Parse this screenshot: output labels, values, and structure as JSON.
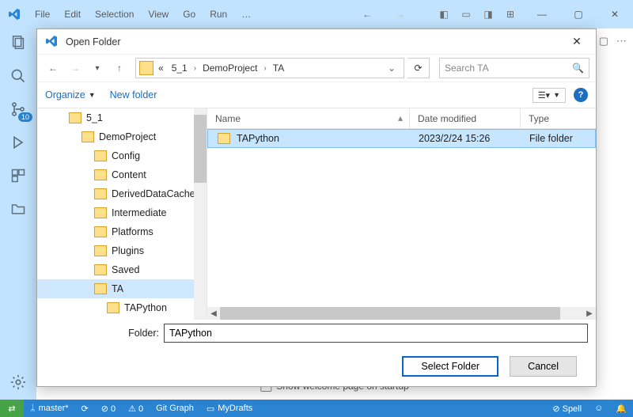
{
  "vsc": {
    "menu": [
      "File",
      "Edit",
      "Selection",
      "View",
      "Go",
      "Run",
      "…"
    ],
    "editor_dots": "⋯",
    "square_icon": "▢",
    "welcome_text": "Show welcome page on startup",
    "status": {
      "branch": "master*",
      "sync": "⟳",
      "errors": "⊘ 0",
      "warnings": "⚠ 0",
      "gitgraph": "Git Graph",
      "mydrafts": "MyDrafts",
      "spell": "⊘ Spell",
      "feedback": "☺",
      "bell": "🔔"
    },
    "badge10": "10"
  },
  "dlg": {
    "title": "Open Folder",
    "breadcrumb": {
      "root": "«",
      "p1": "5_1",
      "p2": "DemoProject",
      "p3": "TA"
    },
    "search_placeholder": "Search TA",
    "organize": "Organize",
    "newfolder": "New folder",
    "help": "?",
    "columns": {
      "name": "Name",
      "date": "Date modified",
      "type": "Type"
    },
    "tree": {
      "n0": "5_1",
      "n1": "DemoProject",
      "n2": "Config",
      "n3": "Content",
      "n4": "DerivedDataCache",
      "n5": "Intermediate",
      "n6": "Platforms",
      "n7": "Plugins",
      "n8": "Saved",
      "n9": "TA",
      "n10": "TAPython"
    },
    "row": {
      "name": "TAPython",
      "date": "2023/2/24 15:26",
      "type": "File folder"
    },
    "folder_label": "Folder:",
    "folder_value": "TAPython",
    "btn_select": "Select Folder",
    "btn_cancel": "Cancel"
  }
}
